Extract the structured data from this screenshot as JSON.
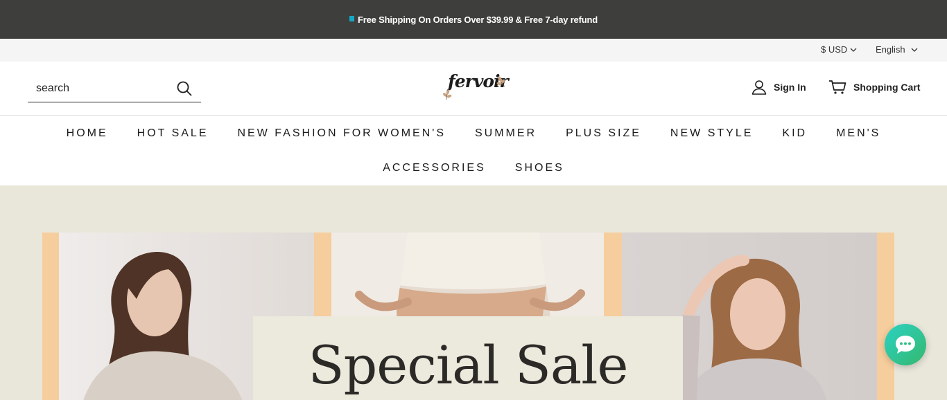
{
  "announcement": {
    "text": "Free Shipping On Orders Over $39.99 & Free 7-day refund"
  },
  "utility": {
    "currency": "$ USD",
    "language": "English"
  },
  "header": {
    "search_placeholder": "search",
    "logo_text": "fervoir",
    "sign_in": "Sign In",
    "cart": "Shopping Cart"
  },
  "nav": {
    "row1": [
      "HOME",
      "HOT SALE",
      "NEW FASHION FOR WOMEN'S",
      "SUMMER",
      "PLUS SIZE",
      "NEW STYLE",
      "KID",
      "MEN'S"
    ],
    "row2": [
      "ACCESSORIES",
      "SHOES"
    ]
  },
  "hero": {
    "title": "Special Sale"
  },
  "colors": {
    "announce_bg": "#3e3e3c",
    "accent": "#17a7c6",
    "hero_bg": "#e9e6da",
    "frame": "#f6cd9d",
    "chat_start": "#2bd2c4",
    "chat_end": "#35b86d"
  },
  "icons": [
    "search-icon",
    "user-icon",
    "cart-icon",
    "chevron-down-icon",
    "chat-icon",
    "logo-flower-icon"
  ]
}
